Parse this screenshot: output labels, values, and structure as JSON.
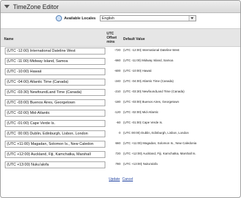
{
  "panel": {
    "title": "TimeZone Editor"
  },
  "locale": {
    "label": "Available Locales",
    "value": "English"
  },
  "table": {
    "col_name": "Name",
    "col_offset": "UTC Offset mins",
    "col_default": "Default Value",
    "rows": [
      {
        "name": "(UTC -12:00) International Dateline West",
        "offset": "-720",
        "default": "(UTC -12:00) International Dateline West"
      },
      {
        "name": "(UTC -11:00) Midway Island, Samoa",
        "offset": "-660",
        "default": "(UTC -11:00) Midway Island, Samoa"
      },
      {
        "name": "(UTC -10:00) Hawaii",
        "offset": "-600",
        "default": "(UTC -10:00) Hawaii"
      },
      {
        "name": "(UTC -04:00) Atlantic Time (Canada)",
        "offset": "-240",
        "default": "(UTC -04:00) Atlantic Time (Canada)"
      },
      {
        "name": "(UTC -03:30) NewfoundLand Time (Canada)",
        "offset": "-210",
        "default": "(UTC -03:30) NewfoundLand Time (Canada)"
      },
      {
        "name": "(UTC -03:00) Buenos Aires, Georgetown",
        "offset": "-180",
        "default": "(UTC -03:00) Buenos Aires, Georgetown"
      },
      {
        "name": "(UTC -02:00) Mid-Atlantic",
        "offset": "-120",
        "default": "(UTC -02:00) Mid-Atlantic"
      },
      {
        "name": "(UTC -01:00) Cape Verde Is.",
        "offset": "-60",
        "default": "(UTC -01:00) Cape Verde Is."
      },
      {
        "name": "(UTC  00:00) Dublin, Edinburgh, Lisbon, London",
        "offset": "0",
        "default": "(UTC 00:00) Dublin, Edinburgh, Lisbon, London"
      },
      {
        "name": "(UTC +11:00) Magadan, Solomon Is., New Caledon",
        "offset": "660",
        "default": "(UTC +11:00) Magadan, Solomon Is., New Caledonia"
      },
      {
        "name": "(UTC +12:00) Auckland, Fiji, Kamchatka, Marshall",
        "offset": "720",
        "default": "(UTC +12:00) Auckland, Fiji, Kamchatka, Marshall Is."
      },
      {
        "name": "(UTC +13:00) Nuku'alofa",
        "offset": "780",
        "default": "(UTC +13:00) Nuku'alofa"
      }
    ]
  },
  "actions": {
    "update": "Update",
    "cancel": "Cancel"
  }
}
